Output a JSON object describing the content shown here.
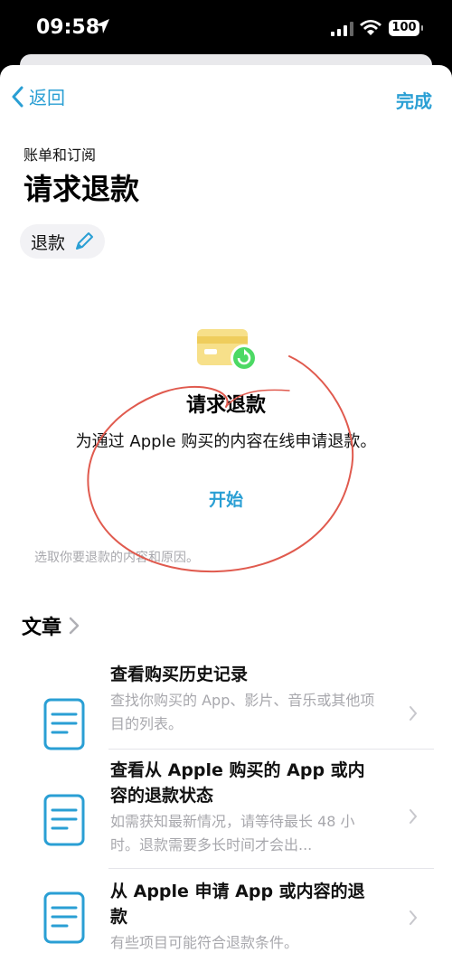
{
  "status": {
    "time": "09:58",
    "battery": "100"
  },
  "nav": {
    "back_label": "返回",
    "done_label": "完成"
  },
  "header": {
    "breadcrumb": "账单和订阅",
    "title": "请求退款"
  },
  "chip": {
    "label": "退款"
  },
  "refund_card": {
    "title": "请求退款",
    "description": "为通过 Apple 购买的内容在线申请退款。",
    "start_label": "开始",
    "hint": "选取你要退款的内容和原因。"
  },
  "articles": {
    "section_title": "文章",
    "items": [
      {
        "title": "查看购买历史记录",
        "subtitle": "查找你购买的 App、影片、音乐或其他项目的列表。"
      },
      {
        "title": "查看从 Apple 购买的 App 或内容的退款状态",
        "subtitle": "如需获知最新情况，请等待最长 48 小时。退款需要多长时间才会出..."
      },
      {
        "title": "从 Apple 申请 App 或内容的退款",
        "subtitle": "有些项目可能符合退款条件。"
      }
    ]
  },
  "colors": {
    "accent": "#2a9fd4",
    "card_yellow": "#f7e08a",
    "badge_green": "#4cd964",
    "annotation": "#e05a4e"
  }
}
